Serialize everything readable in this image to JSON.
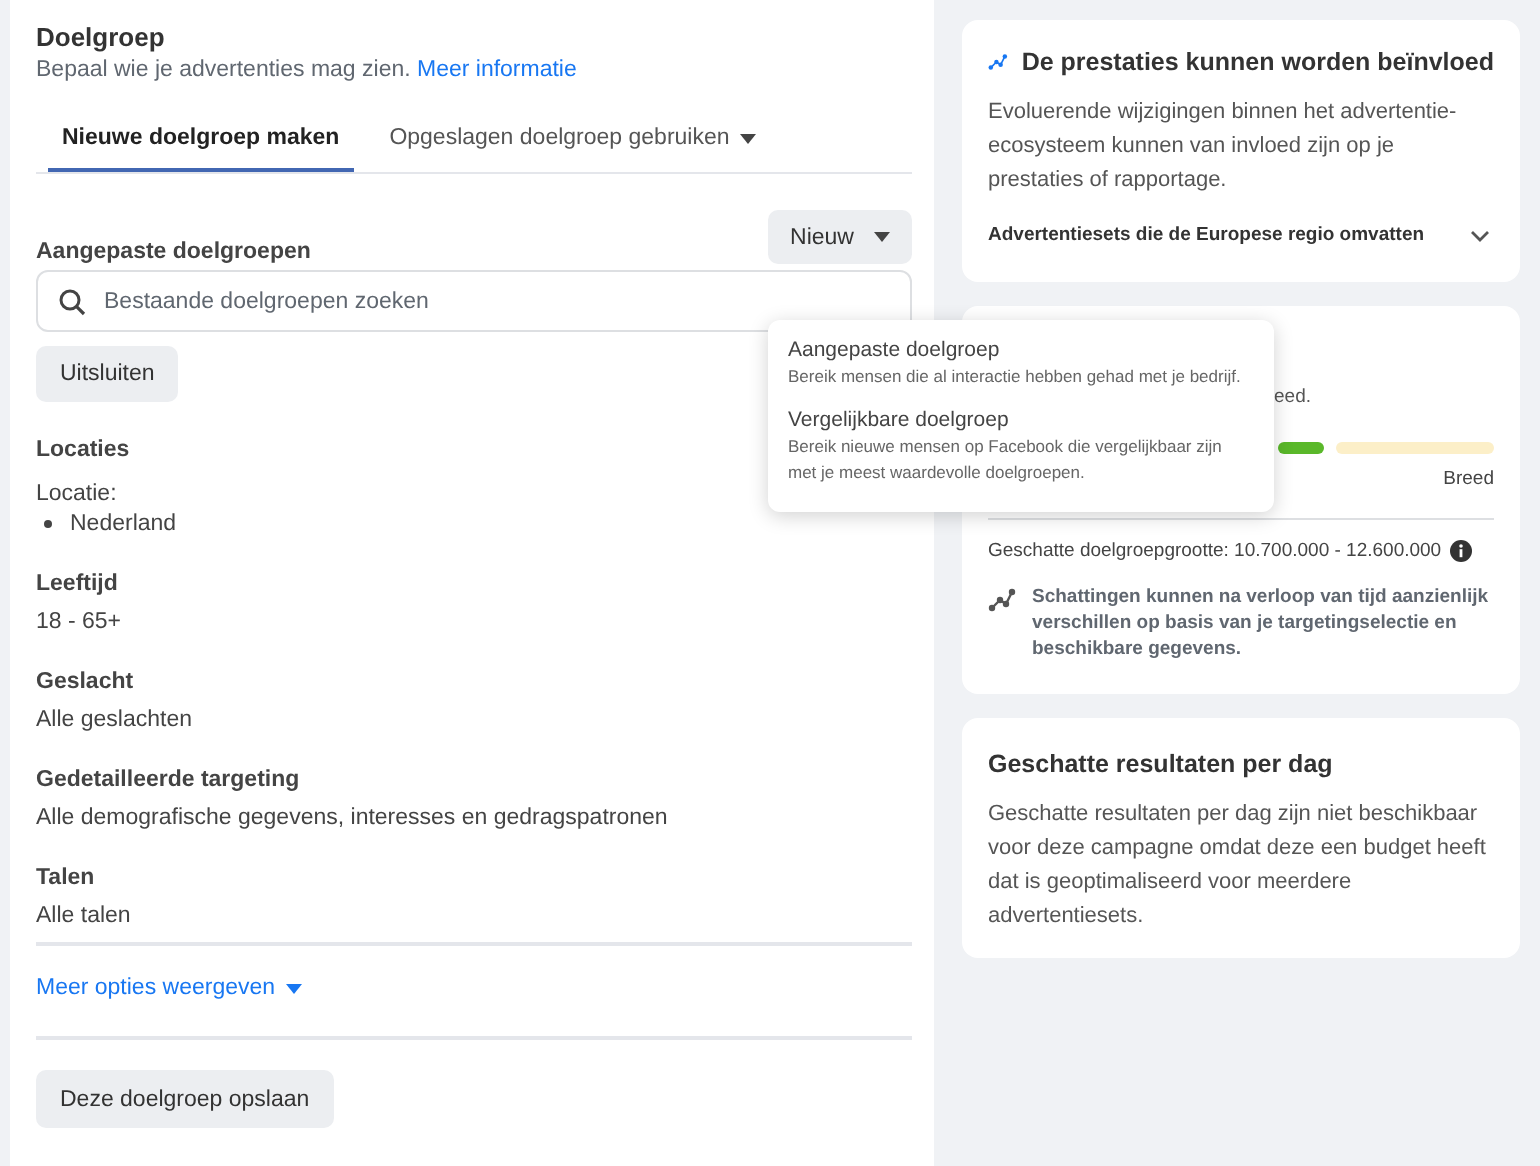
{
  "audience": {
    "title": "Doelgroep",
    "subtitle": "Bepaal wie je advertenties mag zien.",
    "subtitle_link": "Meer informatie",
    "tabs": [
      {
        "label": "Nieuwe doelgroep maken",
        "selected": true,
        "dropdown": false
      },
      {
        "label": "Opgeslagen doelgroep gebruiken",
        "selected": false,
        "dropdown": true
      }
    ],
    "custom_audiences": {
      "label": "Aangepaste doelgroepen",
      "new_button": "Nieuw",
      "search": {
        "placeholder": "Bestaande doelgroepen zoeken"
      },
      "exclude_button": "Uitsluiten"
    },
    "sections": [
      {
        "heading": "Locaties",
        "sublabel": "Locatie:",
        "items": [
          "Nederland"
        ]
      },
      {
        "heading": "Leeftijd",
        "value": "18 - 65+"
      },
      {
        "heading": "Geslacht",
        "value": "Alle geslachten"
      },
      {
        "heading": "Gedetailleerde targeting",
        "value": "Alle demografische gegevens, interesses en gedragspatronen"
      },
      {
        "heading": "Talen",
        "value": "Alle talen"
      }
    ],
    "more_options": "Meer opties weergeven",
    "save_button": "Deze doelgroep opslaan"
  },
  "new_menu": {
    "items": [
      {
        "title": "Aangepaste doelgroep",
        "description": "Bereik mensen die al interactie hebben gehad met je bedrijf."
      },
      {
        "title": "Vergelijkbare doelgroep",
        "description": "Bereik nieuwe mensen op Facebook die vergelijkbaar zijn met je meest waardevolle doelgroepen."
      }
    ]
  },
  "performance_card": {
    "title": "De prestaties kunnen worden beïnvloed",
    "body": "Evoluerende wijzigingen binnen het advertentie-ecosysteem kunnen van invloed zijn op je prestaties of rapportage.",
    "expander": "Advertentiesets die de Europese regio omvatten"
  },
  "definition_card": {
    "partial_text": "eed.",
    "meter_right_label": "Breed",
    "size": "Geschatte doelgroepgrootte: 10.700.000 - 12.600.000",
    "note": "Schattingen kunnen na verloop van tijd aanzienlijk verschillen op basis van je targetingselectie en beschikbare gegevens."
  },
  "results_card": {
    "title": "Geschatte resultaten per dag",
    "body": "Geschatte resultaten per dag zijn niet beschikbaar voor deze campagne omdat deze een budget heeft dat is geoptimaliseerd voor meerdere advertentiesets."
  }
}
